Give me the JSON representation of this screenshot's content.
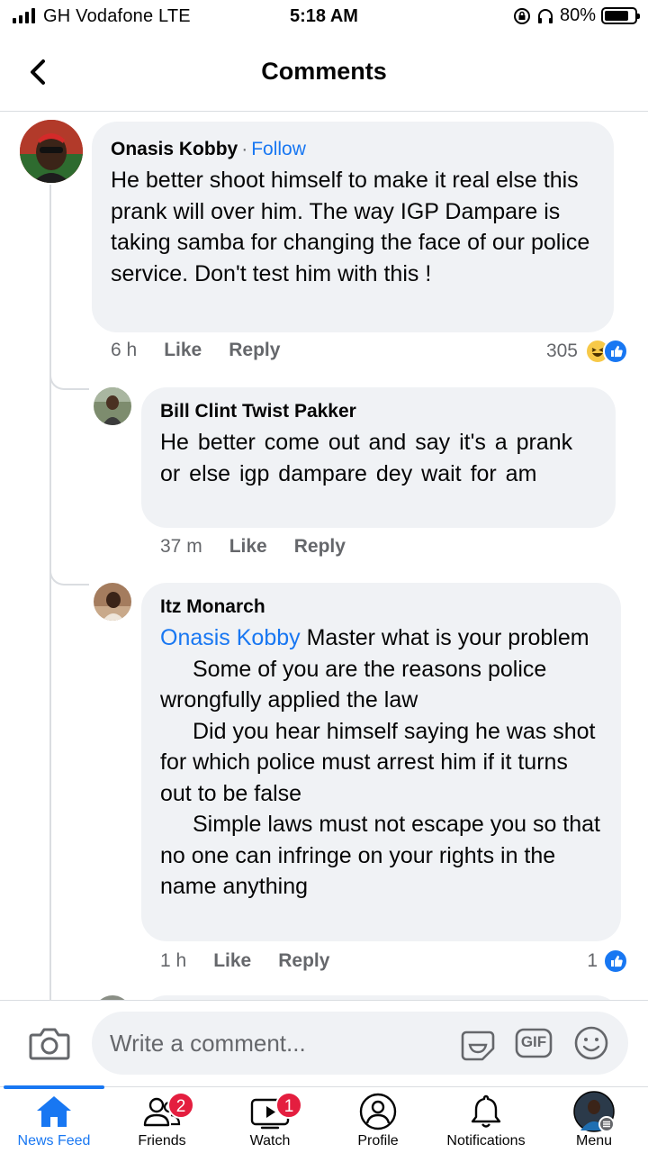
{
  "status_bar": {
    "carrier": "GH Vodafone  LTE",
    "time": "5:18 AM",
    "battery_percent": "80%",
    "battery_level": 0.8
  },
  "header": {
    "title": "Comments"
  },
  "comments": [
    {
      "author": "Onasis Kobby",
      "follow_label": "Follow",
      "text": "He better shoot himself to make it real else this prank will over him. The way IGP Dampare is taking samba for changing the face of our police service. Don't test him with this !",
      "time": "6 h",
      "like_label": "Like",
      "reply_label": "Reply",
      "reaction_count": "305",
      "reactions": [
        "haha",
        "like"
      ]
    },
    {
      "author": "Bill Clint Twist Pakker",
      "text": "He better  come  out  and  say  it's a prank  or  else  igp  dampare  dey  wait for am",
      "time": "37 m",
      "like_label": "Like",
      "reply_label": "Reply"
    },
    {
      "author": "Itz Monarch",
      "mention": "Onasis Kobby",
      "text_after_mention": " Master what is your problem",
      "paragraphs": [
        "Some of you are the reasons police wrongfully applied the law",
        "Did you hear himself saying he was shot for which police must arrest him if it turns out to be false",
        "Simple laws must not escape you so that no one can infringe on your rights in the name anything"
      ],
      "time": "1 h",
      "like_label": "Like",
      "reply_label": "Reply",
      "reaction_count": "1",
      "reactions": [
        "like"
      ]
    }
  ],
  "composer": {
    "placeholder": "Write a comment...",
    "gif_label": "GIF"
  },
  "tabs": [
    {
      "label": "News Feed",
      "icon": "home-icon",
      "active": true
    },
    {
      "label": "Friends",
      "icon": "friends-icon",
      "badge": "2"
    },
    {
      "label": "Watch",
      "icon": "watch-icon",
      "badge": "1"
    },
    {
      "label": "Profile",
      "icon": "profile-icon"
    },
    {
      "label": "Notifications",
      "icon": "bell-icon"
    },
    {
      "label": "Menu",
      "icon": "menu-avatar-icon"
    }
  ],
  "colors": {
    "accent": "#1877f2",
    "bubble": "#f0f2f5",
    "meta_text": "#65676b",
    "badge": "#e41e3f"
  }
}
